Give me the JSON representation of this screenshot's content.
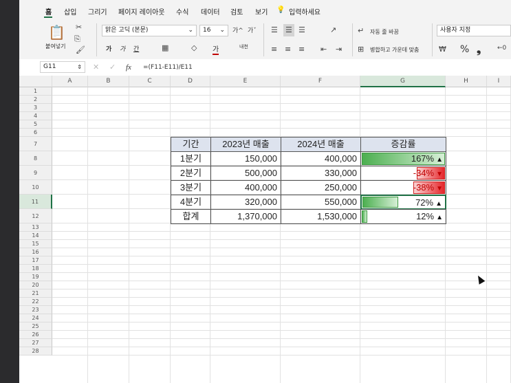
{
  "menu": [
    "홈",
    "삽입",
    "그리기",
    "페이지 레이아웃",
    "수식",
    "데이터",
    "검토",
    "보기"
  ],
  "tell_me": "입력하세요",
  "ribbon": {
    "paste_label": "붙여넣기",
    "font_name": "맑은 고딕 (본문)",
    "font_size": "16",
    "bold": "가",
    "italic": "가",
    "underline": "간",
    "font_color_char": "가",
    "wrap_text": "자동 줄 바꿈",
    "merge_center": "병합하고 가운데 맞춤",
    "number_format": "사용자 지정",
    "percent": "%",
    "comma": "❟",
    "vertical_text": "내천"
  },
  "formula_bar": {
    "name_box": "G11",
    "fx": "fx",
    "formula": "=(F11-E11)/E11"
  },
  "columns": [
    "A",
    "B",
    "C",
    "D",
    "E",
    "F",
    "G",
    "H",
    "I"
  ],
  "rows": [
    "1",
    "2",
    "3",
    "4",
    "5",
    "6",
    "7",
    "8",
    "9",
    "10",
    "11",
    "12",
    "13",
    "14",
    "15",
    "16",
    "17",
    "18",
    "19",
    "20",
    "21",
    "22",
    "23",
    "24",
    "25",
    "26",
    "27",
    "28"
  ],
  "table": {
    "headers": [
      "기간",
      "2023년 매출",
      "2024년 매출",
      "증감률"
    ],
    "rows": [
      {
        "label": "1분기",
        "y2023": "150,000",
        "y2024": "400,000",
        "pct": "167%",
        "dir": "up",
        "fill": 1.0
      },
      {
        "label": "2분기",
        "y2023": "500,000",
        "y2024": "330,000",
        "pct": "-34%",
        "dir": "down",
        "fill": 0.34
      },
      {
        "label": "3분기",
        "y2023": "400,000",
        "y2024": "250,000",
        "pct": "-38%",
        "dir": "down",
        "fill": 0.38
      },
      {
        "label": "4분기",
        "y2023": "320,000",
        "y2024": "550,000",
        "pct": "72%",
        "dir": "up",
        "fill": 0.43
      },
      {
        "label": "합계",
        "y2023": "1,370,000",
        "y2024": "1,530,000",
        "pct": "12%",
        "dir": "up",
        "fill": 0.07
      }
    ]
  },
  "colors": {
    "positive_bar": "#4caf50",
    "negative_bar": "#e5252a",
    "up_arrow": "#111111",
    "down_arrow": "#c00000",
    "header_fill": "#dde3ee"
  }
}
